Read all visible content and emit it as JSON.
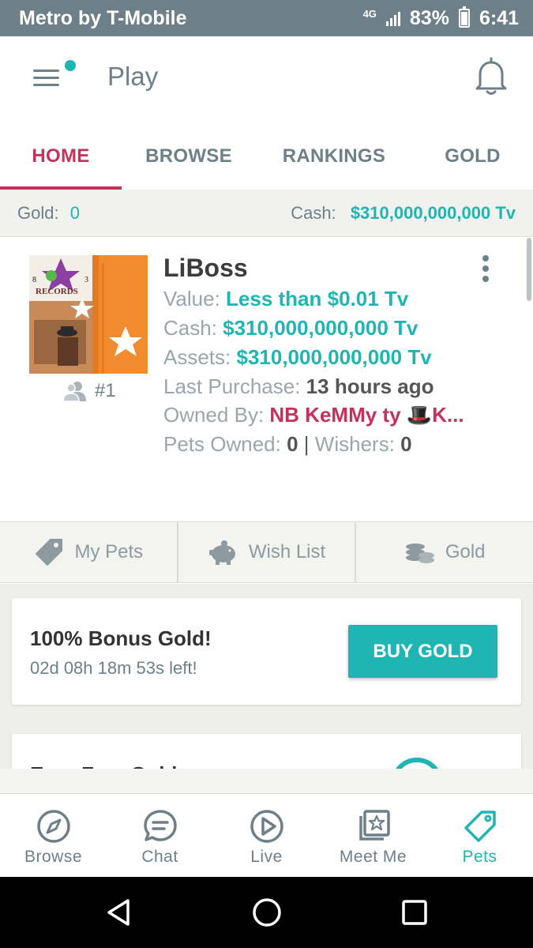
{
  "status_bar": {
    "carrier": "Metro by T-Mobile",
    "network": "4G",
    "battery": "83%",
    "battery_level": 0.83,
    "time": "6:41"
  },
  "header": {
    "title": "Play"
  },
  "tabs": [
    {
      "label": "HOME",
      "active": true
    },
    {
      "label": "BROWSE",
      "active": false
    },
    {
      "label": "RANKINGS",
      "active": false
    },
    {
      "label": "GOLD",
      "active": false
    }
  ],
  "balance": {
    "gold_label": "Gold:",
    "gold_value": "0",
    "cash_label": "Cash:",
    "cash_value": "$310,000,000,000 Tv"
  },
  "profile": {
    "name": "LiBoss",
    "rank": "#1",
    "avatar_text": "RECORDS",
    "avatar_digits": [
      "8",
      "3"
    ],
    "value_label": "Value:",
    "value": "Less than $0.01 Tv",
    "cash_label": "Cash:",
    "cash": "$310,000,000,000 Tv",
    "assets_label": "Assets:",
    "assets": "$310,000,000,000 Tv",
    "last_purchase_label": "Last Purchase:",
    "last_purchase": "13 hours ago",
    "owned_by_label": "Owned By:",
    "owned_by": "NB KeMMy ty 🎩K...",
    "pets_owned_label": "Pets Owned:",
    "pets_owned": "0",
    "separator": "|",
    "wishers_label": "Wishers:",
    "wishers": "0"
  },
  "actions": [
    {
      "label": "My Pets",
      "icon": "tag-icon"
    },
    {
      "label": "Wish List",
      "icon": "piggy-bank-icon"
    },
    {
      "label": "Gold",
      "icon": "coins-icon"
    }
  ],
  "promo": {
    "title": "100% Bonus Gold!",
    "timer": "02d 08h 18m 53s left!",
    "button": "BUY GOLD"
  },
  "next_card": {
    "title": "Earn Free Gold"
  },
  "bottom_nav": [
    {
      "label": "Browse",
      "icon": "compass-icon",
      "active": false
    },
    {
      "label": "Chat",
      "icon": "chat-icon",
      "active": false
    },
    {
      "label": "Live",
      "icon": "play-icon",
      "active": false
    },
    {
      "label": "Meet Me",
      "icon": "photo-stack-icon",
      "active": false
    },
    {
      "label": "Pets",
      "icon": "tag-icon",
      "active": true
    }
  ],
  "colors": {
    "accent_teal": "#1fb5b3",
    "accent_pink": "#c4325c",
    "status_bar": "#6d7f88"
  }
}
